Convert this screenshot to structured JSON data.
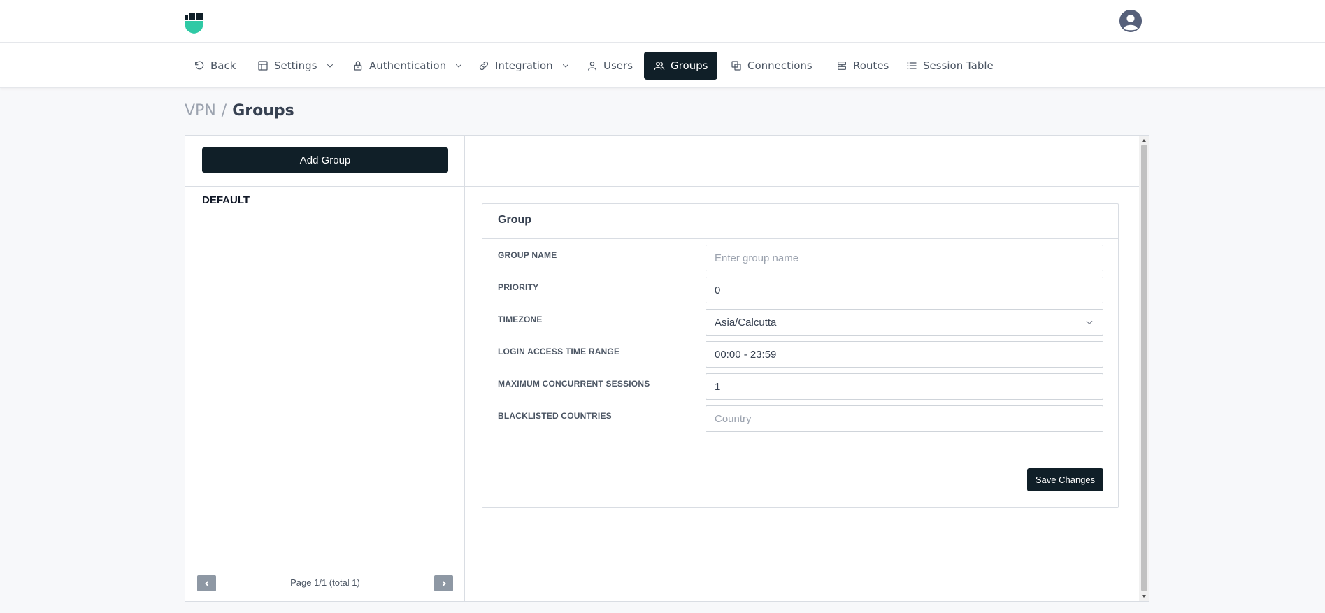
{
  "header": {
    "logo_icon": "fist-shield-logo",
    "avatar_icon": "user-avatar-icon"
  },
  "nav": {
    "items": [
      {
        "label": "Back",
        "icon": "undo-icon",
        "dropdown": false,
        "active": false
      },
      {
        "label": "Settings",
        "icon": "layout-icon",
        "dropdown": true,
        "active": false
      },
      {
        "label": "Authentication",
        "icon": "lock-icon",
        "dropdown": true,
        "active": false
      },
      {
        "label": "Integration",
        "icon": "link-icon",
        "dropdown": true,
        "active": false
      },
      {
        "label": "Users",
        "icon": "user-icon",
        "dropdown": false,
        "active": false
      },
      {
        "label": "Groups",
        "icon": "users-icon",
        "dropdown": false,
        "active": true
      },
      {
        "label": "Connections",
        "icon": "connections-icon",
        "dropdown": false,
        "active": false
      },
      {
        "label": "Routes",
        "icon": "routes-icon",
        "dropdown": false,
        "active": false
      },
      {
        "label": "Session Table",
        "icon": "list-icon",
        "dropdown": false,
        "active": false
      }
    ]
  },
  "breadcrumb": {
    "root": "VPN",
    "separator": "/",
    "current": "Groups"
  },
  "groups_panel": {
    "add_button": "Add Group",
    "items": [
      "DEFAULT"
    ],
    "pagination": {
      "text": "Page 1/1 (total 1)"
    }
  },
  "form": {
    "title": "Group",
    "fields": {
      "group_name": {
        "label": "GROUP NAME",
        "value": "",
        "placeholder": "Enter group name"
      },
      "priority": {
        "label": "PRIORITY",
        "value": "0",
        "placeholder": ""
      },
      "timezone": {
        "label": "TIMEZONE",
        "value": "Asia/Calcutta"
      },
      "login_access": {
        "label": "LOGIN ACCESS TIME RANGE",
        "value": "00:00 - 23:59",
        "placeholder": ""
      },
      "max_sessions": {
        "label": "MAXIMUM CONCURRENT SESSIONS",
        "value": "1",
        "placeholder": ""
      },
      "blacklisted": {
        "label": "BLACKLISTED COUNTRIES",
        "value": "",
        "placeholder": "Country"
      }
    },
    "save_button": "Save Changes"
  },
  "colors": {
    "primary_dark": "#101f28",
    "accent_teal": "#2fc9a5"
  }
}
